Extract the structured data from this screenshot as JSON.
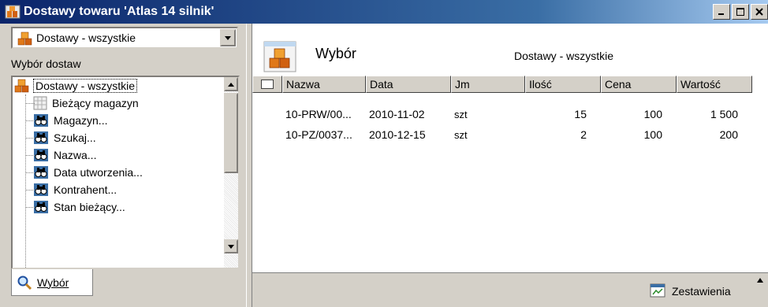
{
  "window": {
    "title": "Dostawy towaru 'Atlas 14 silnik'",
    "controls": [
      "minimize",
      "maximize",
      "close"
    ]
  },
  "left": {
    "combo_value": "Dostawy - wszystkie",
    "section_label": "Wybór dostaw",
    "tree": [
      {
        "label": "Dostawy - wszystkie",
        "icon": "stack-boxes-icon",
        "level": 0
      },
      {
        "label": "Bieżący magazyn",
        "icon": "grid-doc-icon",
        "level": 1
      },
      {
        "label": "Magazyn...",
        "icon": "binoculars-icon",
        "level": 1
      },
      {
        "label": "Szukaj...",
        "icon": "binoculars-icon",
        "level": 1
      },
      {
        "label": "Nazwa...",
        "icon": "binoculars-icon",
        "level": 1
      },
      {
        "label": "Data utworzenia...",
        "icon": "binoculars-icon",
        "level": 1
      },
      {
        "label": "Kontrahent...",
        "icon": "binoculars-icon",
        "level": 1
      },
      {
        "label": "Stan bieżący...",
        "icon": "binoculars-icon",
        "level": 1
      }
    ],
    "tab_label": "Wybór"
  },
  "right": {
    "title": "Wybór",
    "subtitle": "Dostawy - wszystkie",
    "columns": [
      "Nazwa",
      "Data",
      "Jm",
      "Ilość",
      "Cena",
      "Wartość"
    ],
    "rows": [
      {
        "nazwa": "10-PRW/00...",
        "data": "2010-11-02",
        "jm": "szt",
        "ilosc": "15",
        "cena": "100",
        "wartosc": "1 500"
      },
      {
        "nazwa": "10-PZ/0037...",
        "data": "2010-12-15",
        "jm": "szt",
        "ilosc": "2",
        "cena": "100",
        "wartosc": "200"
      }
    ],
    "zestawienia_label": "Zestawienia"
  }
}
